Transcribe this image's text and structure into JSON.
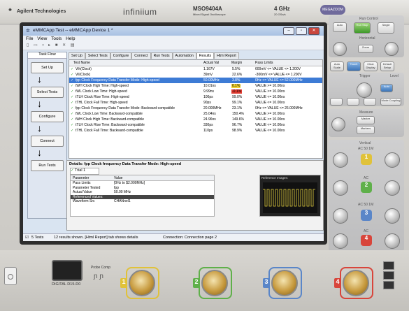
{
  "scope": {
    "brand": "Agilent Technologies",
    "logo": "infiniium",
    "model": "MSO9404A",
    "model_sub": "Mixed Signal Oscilloscope",
    "bandwidth": "4 GHz",
    "sample_rate": "20 GSa/s",
    "badge": "MEGAZOOM"
  },
  "window": {
    "title": "eMMCApp Test -- eMMCApp Device 1 *",
    "menu": [
      "File",
      "View",
      "Tools",
      "Help"
    ]
  },
  "task_flow": {
    "header": "Task Flow",
    "steps": [
      "Set Up",
      "Select Tests",
      "Configure",
      "Connect",
      "Run Tests"
    ]
  },
  "tabs": [
    "Set Up",
    "Select Tests",
    "Configure",
    "Connect",
    "Run Tests",
    "Automation",
    "Results",
    "Html Report"
  ],
  "results": {
    "columns": [
      "Test Name",
      "Actual Val",
      "Margin",
      "Pass Limits"
    ],
    "rows": [
      {
        "name": "Vih(Clock)",
        "actual": "1.167V",
        "margin": "5.5%",
        "limits": "600mV <= VALUE <= 1.200V"
      },
      {
        "name": "Vil(Clock)",
        "actual": "39mV",
        "margin": "22.6%",
        "limits": "-300mV <= VALUE <= 1.200V"
      },
      {
        "name": "fpp Clock Frequency Data Transfer Mode: High-speed",
        "actual": "50.00MHz",
        "margin": "3.8%",
        "limits": "0Hz <= VALUE <= 52.000MHz"
      },
      {
        "name": "tWH Clock High Time: High-speed",
        "actual": "10.01ns",
        "margin": "0.1%",
        "limits": "VALUE >= 10.00ns"
      },
      {
        "name": "tWL Clock Low Time: High-speed",
        "actual": "9.99ns",
        "margin": "-0.1%",
        "limits": "VALUE >= 10.00ns"
      },
      {
        "name": "tTLH Clock Rise Time: High-speed",
        "actual": "100ps",
        "margin": "99.0%",
        "limits": "VALUE <= 10.00ns"
      },
      {
        "name": "tTHL Clock Fall Time: High-speed",
        "actual": "90ps",
        "margin": "99.1%",
        "limits": "VALUE <= 10.00ns"
      },
      {
        "name": "fpp Clock Frequency Data Transfer Mode: Backward-compatible",
        "actual": "20.000MHz",
        "margin": "23.1%",
        "limits": "0Hz <= VALUE <= 26.000MHz"
      },
      {
        "name": "tWL Clock Low Time: Backward-compatible",
        "actual": "25.04ns",
        "margin": "150.4%",
        "limits": "VALUE >= 10.00ns"
      },
      {
        "name": "tWH Clock High Time: Backward-compatible",
        "actual": "24.96ns",
        "margin": "149.6%",
        "limits": "VALUE >= 10.00ns"
      },
      {
        "name": "tTLH Clock Rise Time: Backward-compatible",
        "actual": "330ps",
        "margin": "96.7%",
        "limits": "VALUE <= 10.00ns"
      },
      {
        "name": "tTHL Clock Fall Time: Backward-compatible",
        "actual": "110ps",
        "margin": "98.9%",
        "limits": "VALUE <= 10.00ns"
      }
    ]
  },
  "details": {
    "title": "Details: fpp Clock frequency Data Transfer Mode: High-speed",
    "trial_tab": "Trial 1",
    "columns": [
      "Parameter",
      "Value"
    ],
    "rows": [
      {
        "param": "Pass Limits",
        "value": "[0Hz to $2.000MHz]"
      },
      {
        "param": "Parameter Tested",
        "value": "fpp"
      },
      {
        "param": "Actual Value",
        "value": "50.00 MHz"
      },
      {
        "param": "Referenced Values:",
        "value": ""
      },
      {
        "param": "Waveform Src",
        "value": "CHANnel1"
      }
    ],
    "ref_label": "Reference Images:"
  },
  "status": {
    "tests": "5 Tests",
    "message": "12 results shown. [Html Report] tab shows details",
    "connection": "Connection: Connection page 2"
  },
  "panel": {
    "run_control": "Run Control",
    "auto": "Auto",
    "run_stop": "Run Stop",
    "single": "Single",
    "horizontal": "Horizontal",
    "zoom": "Zoom",
    "auto_scale": "Auto Scale",
    "touch": "Touch",
    "clear_display": "Clear Display",
    "default_setup": "Default Setup",
    "trigger": "Trigger",
    "level": "Level",
    "mode_coupling": "Mode Coupling",
    "measure": "Measure",
    "marker": "Marker",
    "markers": "Markers",
    "vertical": "Vertical",
    "ac_50_1m": "AC  50  1M",
    "ac": "AC",
    "ch1": "1",
    "ch2": "2",
    "ch3": "3",
    "ch4": "4"
  },
  "bottom": {
    "digital": "DIGITAL D15-D0",
    "probe_comp": "Probe Comp",
    "ch1": "1",
    "ch2": "2",
    "ch3": "3",
    "ch4": "4"
  }
}
